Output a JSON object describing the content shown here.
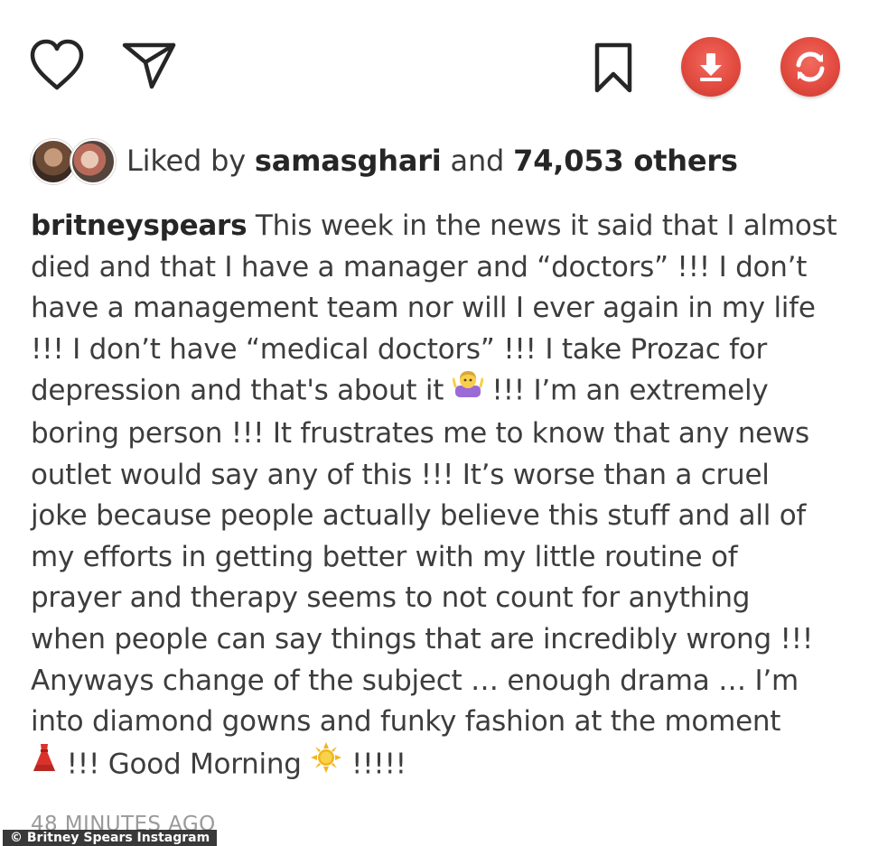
{
  "actions": {
    "like_icon": "heart-outline-icon",
    "share_icon": "paper-plane-icon",
    "save_icon": "bookmark-outline-icon",
    "download_icon": "download-arrow-icon",
    "refresh_icon": "refresh-arrows-icon",
    "accent_color": "#e24b40"
  },
  "likes": {
    "prefix": "Liked by ",
    "user": "samasghari",
    "middle": " and ",
    "count": "74,053 others"
  },
  "caption": {
    "username": "britneyspears",
    "lines": [
      " This week in the news it said that I almost",
      "died and that I have a manager and “doctors” !!! I don’t",
      "have a management team nor will I ever again in my life",
      "!!! I don’t have “medical doctors” !!! I take Prozac for",
      "depression and that's about it",
      " !!! I’m an extremely",
      "boring person !!! It frustrates me to know that any news",
      "outlet would say any of this !!! It’s worse than a cruel",
      "joke because people actually believe this stuff and all of",
      "my efforts in getting better with my little routine of",
      "prayer and therapy seems to not count for anything",
      "when people can say things that are incredibly wrong !!!",
      "Anyways change of the subject … enough drama … I’m",
      "into diamond gowns and funky fashion at the moment",
      " !!! Good Morning ",
      " !!!!!"
    ],
    "emojis": {
      "shrug": "woman-shrugging-emoji",
      "dress": "red-dress-emoji",
      "sun": "sun-emoji"
    }
  },
  "timestamp": "48 MINUTES AGO",
  "credit": "© Britney Spears Instagram"
}
